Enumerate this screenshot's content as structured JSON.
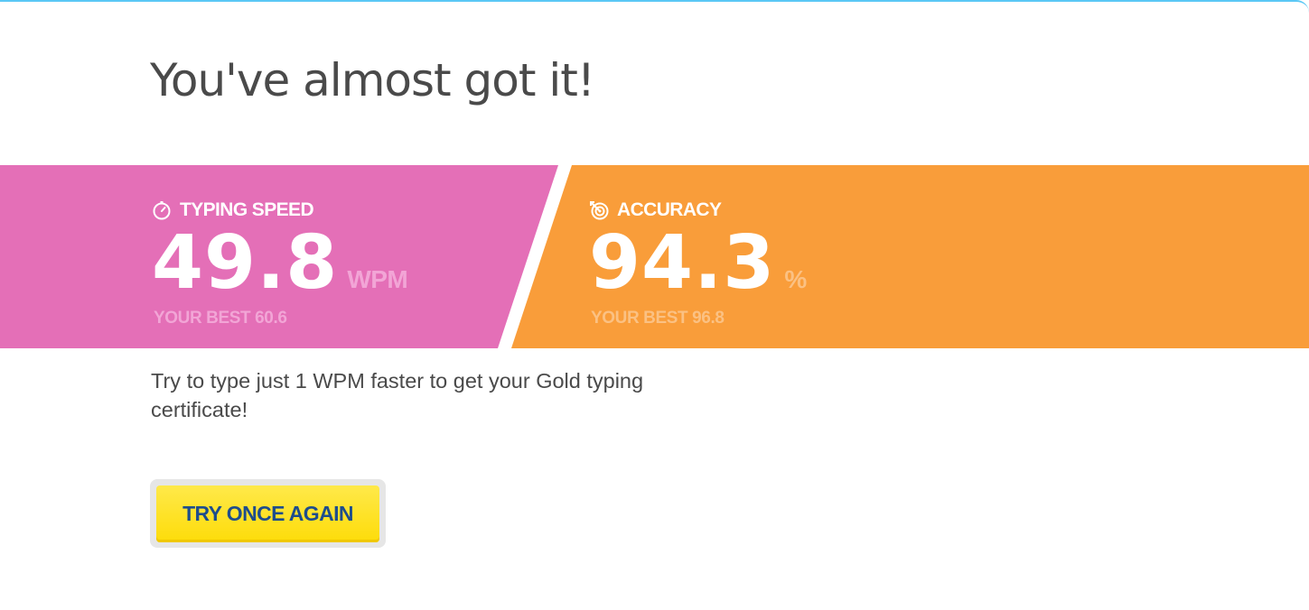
{
  "heading": "You've almost got it!",
  "speed": {
    "icon": "stopwatch-icon",
    "label": "TYPING SPEED",
    "value": "49.8",
    "unit": "WPM",
    "best": "YOUR BEST 60.6",
    "color": "#e46fb7"
  },
  "accuracy": {
    "icon": "target-icon",
    "label": "ACCURACY",
    "value": "94.3",
    "unit": "%",
    "best": "YOUR BEST 96.8",
    "color": "#f99d3a"
  },
  "message": "Try to type just 1 WPM faster to get your Gold typing certificate!",
  "button": {
    "label": "TRY ONCE AGAIN",
    "color": "#fee21b",
    "text_color": "#1e4d8c"
  },
  "accent_color": "#5bc8f5"
}
